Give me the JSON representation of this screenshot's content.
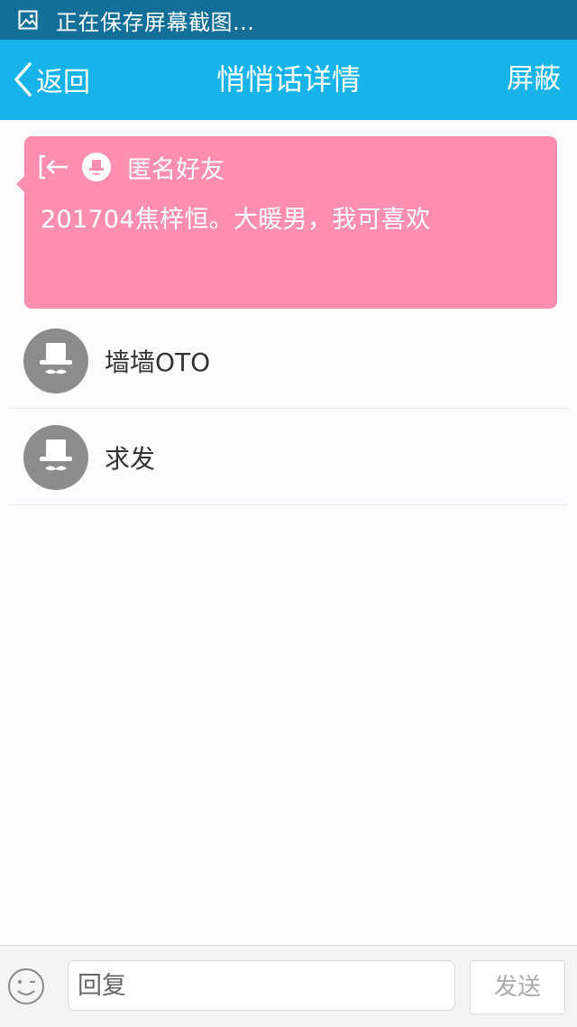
{
  "status_bar": {
    "text": "正在保存屏幕截图...",
    "icon": "image-icon"
  },
  "header": {
    "back_label": "返回",
    "title": "悄悄话详情",
    "action_label": "屏蔽"
  },
  "message": {
    "author": "匿名好友",
    "text": "201704焦梓恒。大暖男，我可喜欢",
    "card_color": "#fe8fb1"
  },
  "replies": [
    {
      "name": "墙墙OTO"
    },
    {
      "name": "求发"
    }
  ],
  "reply_bar": {
    "placeholder": "回复",
    "value": "",
    "send_label": "发送"
  },
  "colors": {
    "status_bar": "#126f98",
    "title_bar": "#17b3e9",
    "avatar": "#8d8b8e"
  }
}
